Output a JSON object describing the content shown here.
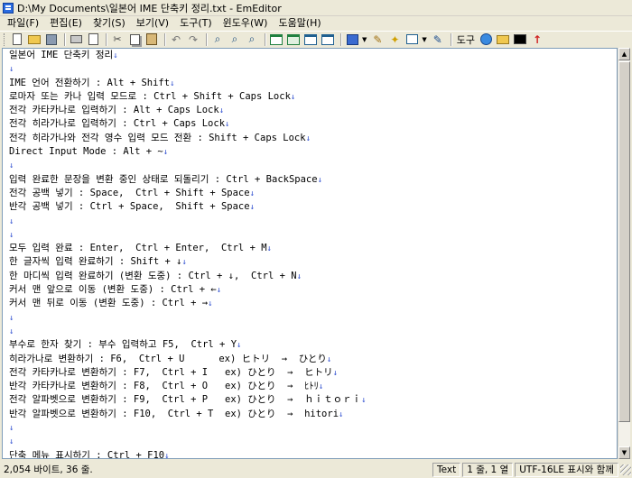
{
  "window": {
    "title": "D:\\My Documents\\일본어 IME 단축키 정리.txt - EmEditor"
  },
  "menu": [
    "파일(F)",
    "편집(E)",
    "찾기(S)",
    "보기(V)",
    "도구(T)",
    "윈도우(W)",
    "도움말(H)"
  ],
  "toolbar": {
    "tools_label": "도구"
  },
  "editor": {
    "lines": [
      "일본어 IME 단축키 정리",
      "",
      "IME 언어 전환하기 : Alt + Shift",
      "로마자 또는 카나 입력 모드로 : Ctrl + Shift + Caps Lock",
      "전각 카타카나로 입력하기 : Alt + Caps Lock",
      "전각 히라가나로 입력하기 : Ctrl + Caps Lock",
      "전각 히라가나와 전각 영수 입력 모드 전환 : Shift + Caps Lock",
      "Direct Input Mode : Alt + ~",
      "",
      "입력 완료한 문장을 변환 중인 상태로 되돌리기 : Ctrl + BackSpace",
      "전각 공백 넣기 : Space,  Ctrl + Shift + Space",
      "반각 공백 넣기 : Ctrl + Space,  Shift + Space",
      "",
      "",
      "모두 입력 완료 : Enter,  Ctrl + Enter,  Ctrl + M",
      "한 글자씩 입력 완료하기 : Shift + ↓",
      "한 마디씩 입력 완료하기 (변환 도중) : Ctrl + ↓,  Ctrl + N",
      "커서 맨 앞으로 이동 (변환 도중) : Ctrl + ←",
      "커서 맨 뒤로 이동 (변환 도중) : Ctrl + →",
      "",
      "",
      "부수로 한자 찾기 : 부수 입력하고 F5,  Ctrl + Y",
      "히라가나로 변환하기 : F6,  Ctrl + U      ex) ヒトリ  →  ひとり",
      "전각 카타카나로 변환하기 : F7,  Ctrl + I   ex) ひとり  →  ヒトリ",
      "반각 카타카나로 변환하기 : F8,  Ctrl + O   ex) ひとり  →  ﾋﾄﾘ",
      "전각 알파벳으로 변환하기 : F9,  Ctrl + P   ex) ひとり  →  ｈｉｔｏｒｉ",
      "반각 알파벳으로 변환하기 : F10,  Ctrl + T  ex) ひとり  →  hitori",
      "",
      "",
      "단축 메뉴 표시하기 : Ctrl + F10"
    ],
    "eol_mark": "↓"
  },
  "status": {
    "summary": "2,054 바이트, 36 줄.",
    "mode": "Text",
    "position": "1 줄, 1 열",
    "encoding": "UTF-16LE 표시와 함께"
  }
}
